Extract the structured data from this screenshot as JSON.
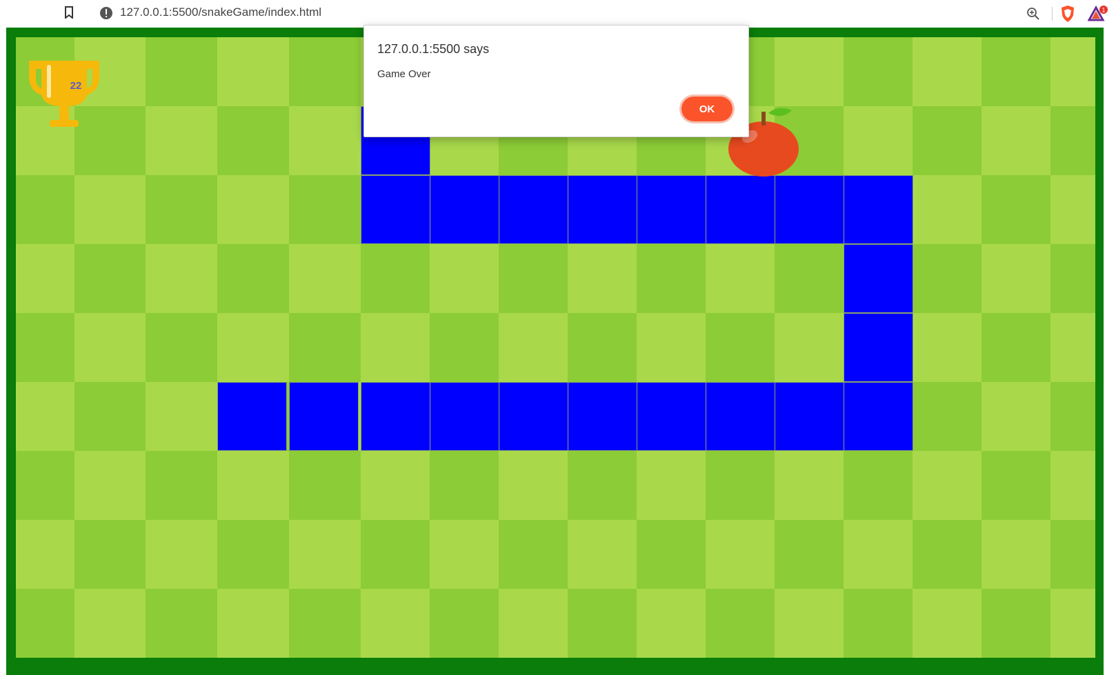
{
  "browser": {
    "url": "127.0.0.1:5500/snakeGame/index.html",
    "rewards_badge": "1",
    "icons": [
      "bookmark-icon",
      "site-info-icon",
      "zoom-icon",
      "brave-shield-icon",
      "brave-rewards-icon"
    ]
  },
  "game": {
    "score": "22",
    "colors": {
      "border": "#0a7d0a",
      "light_tile": "#a9d94b",
      "dark_tile": "#8ccc37",
      "snake": "#0000ff",
      "apple": "#e84a1f"
    },
    "icons": [
      "trophy-icon",
      "apple-icon"
    ]
  },
  "dialog": {
    "title": "127.0.0.1:5500 says",
    "message": "Game Over",
    "ok_label": "OK",
    "accent": "#fb542b"
  }
}
